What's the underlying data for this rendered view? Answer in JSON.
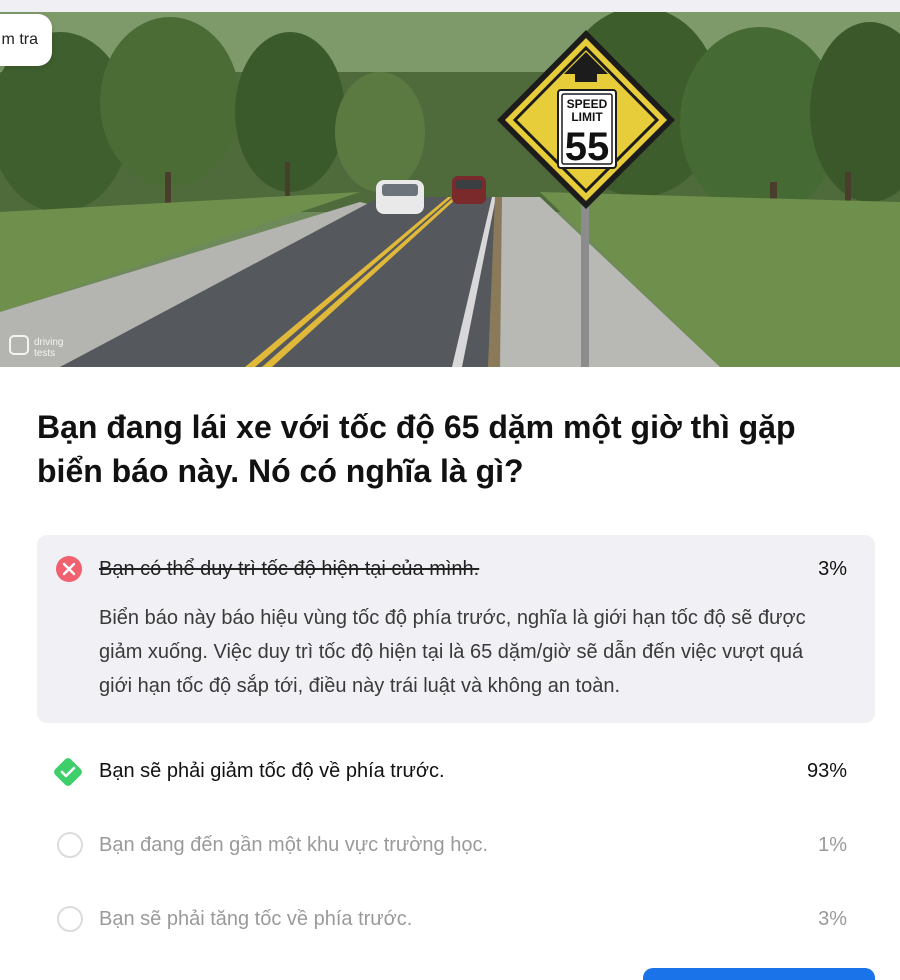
{
  "tab": {
    "label": "m tra"
  },
  "image": {
    "sign_line1": "SPEED",
    "sign_line2": "LIMIT",
    "sign_number": "55",
    "watermark_line1": "driving",
    "watermark_line2": "tests"
  },
  "question": {
    "text": "Bạn đang lái xe với tốc độ 65 dặm một giờ thì gặp biển báo này. Nó có nghĩa là gì?"
  },
  "answers": [
    {
      "text": "Bạn có thể duy trì tốc độ hiện tại của mình.",
      "percent": "3%",
      "state": "wrong",
      "explanation": "Biển báo này báo hiệu vùng tốc độ phía trước, nghĩa là giới hạn tốc độ sẽ được giảm xuống. Việc duy trì tốc độ hiện tại là 65 dặm/giờ sẽ dẫn đến việc vượt quá giới hạn tốc độ sắp tới, điều này trái luật và không an toàn."
    },
    {
      "text": "Bạn sẽ phải giảm tốc độ về phía trước.",
      "percent": "93%",
      "state": "correct"
    },
    {
      "text": "Bạn đang đến gần một khu vực trường học.",
      "percent": "1%",
      "state": "unselected"
    },
    {
      "text": "Bạn sẽ phải tăng tốc về phía trước.",
      "percent": "3%",
      "state": "unselected"
    }
  ],
  "colors": {
    "wrong": "#f0606f",
    "correct": "#3ecf6a",
    "accent": "#1a73e8",
    "panel": "#f1f1f5"
  }
}
